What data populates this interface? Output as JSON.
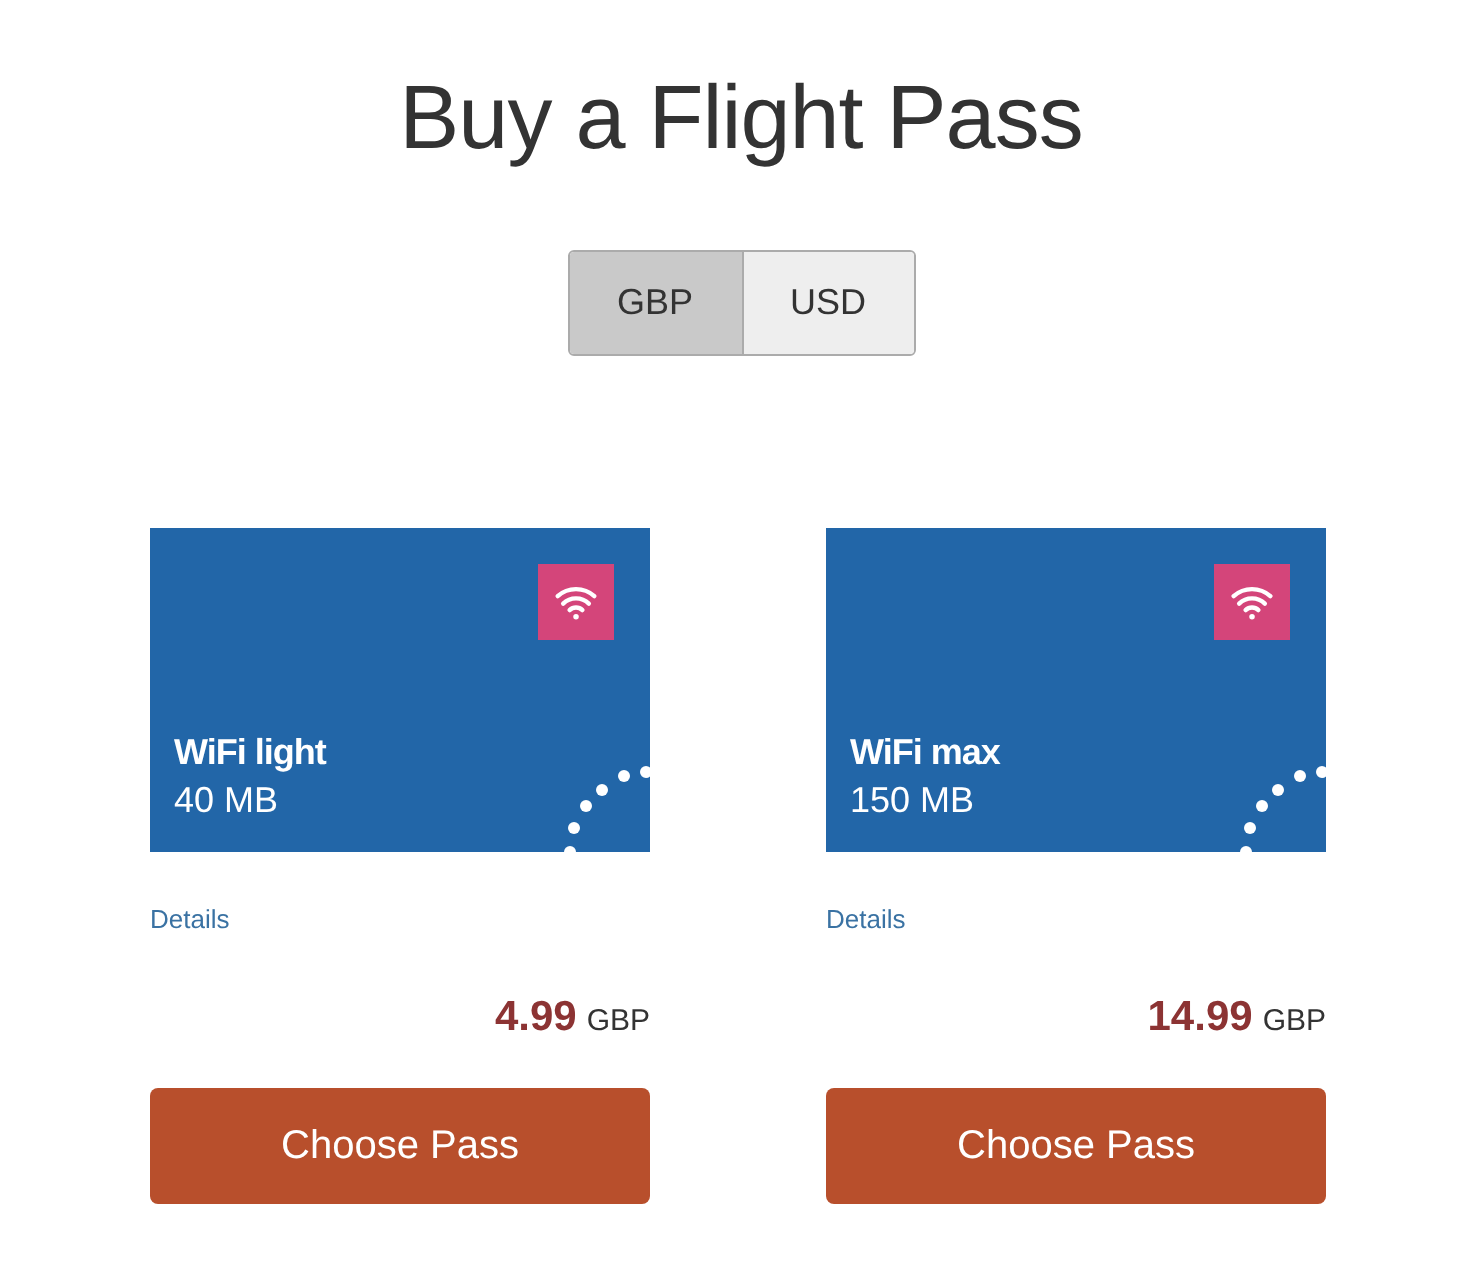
{
  "title": "Buy a Flight Pass",
  "currency_toggle": [
    {
      "label": "GBP",
      "selected": true
    },
    {
      "label": "USD",
      "selected": false
    }
  ],
  "passes": [
    {
      "name": "WiFi light",
      "allowance": "40 MB",
      "details_link": "Details",
      "price": "4.99",
      "currency": "GBP",
      "button": "Choose Pass"
    },
    {
      "name": "WiFi max",
      "allowance": "150 MB",
      "details_link": "Details",
      "price": "14.99",
      "currency": "GBP",
      "button": "Choose Pass"
    }
  ]
}
